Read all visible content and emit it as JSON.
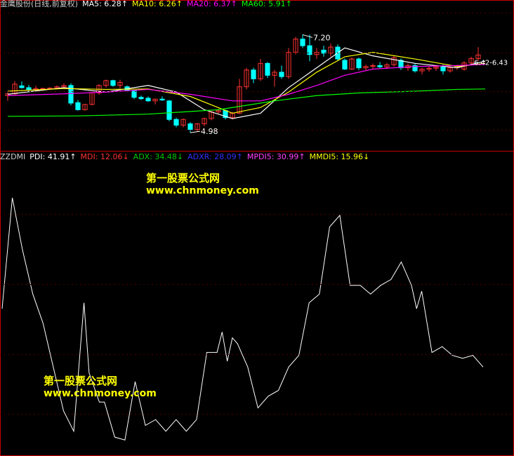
{
  "colors": {
    "background": "#000000",
    "up": "#ff3232",
    "down": "#00ffff",
    "axis_red": "#c80000",
    "grid_red": "#500000",
    "ma5": "#ffffff",
    "ma10": "#ffff00",
    "ma20": "#ff00ff",
    "ma60": "#00ff00",
    "pdi": "#ffffff",
    "mdi": "#ff0000",
    "adx": "#00c800",
    "adxr": "#2020ff",
    "mpdi5": "#ff40ff",
    "mmdi5": "#ffff00"
  },
  "top_legend": {
    "title": "金鹰股份(日线,前复权)",
    "ma5": "MA5: 6.28↑",
    "ma10": "MA10: 6.26↑",
    "ma20": "MA20: 6.37↑",
    "ma60": "MA60: 5.91↑"
  },
  "bottom_legend": {
    "title": "ZZDMI",
    "pdi": "PDI: 41.91↑",
    "mdi": "MDI: 12.06↓",
    "adx": "ADX: 34.48↓",
    "adxr": "ADXR: 28.09↑",
    "mpdi5": "MPDI5: 30.99↑",
    "mmdi5": "MMDI5: 15.96↓"
  },
  "watermarks": [
    {
      "cn": "第一股票公式网",
      "url": "www.chnmoney.com"
    },
    {
      "cn": "第一股票公式网",
      "url": "www.chnmoney.com"
    }
  ],
  "chart_data": [
    {
      "type": "candlestick",
      "ylim": [
        4.6,
        7.7
      ],
      "annotations": {
        "high": "7.20",
        "low": "4.98",
        "last_range": "6.42-6.43"
      },
      "candles": [
        [
          5.82,
          5.9,
          5.7,
          5.86
        ],
        [
          5.86,
          6.15,
          5.82,
          6.08
        ],
        [
          6.04,
          6.14,
          5.98,
          6.0
        ],
        [
          6.0,
          6.06,
          5.9,
          5.96
        ],
        [
          5.96,
          6.04,
          5.92,
          5.98
        ],
        [
          5.98,
          6.0,
          5.95,
          5.98
        ],
        [
          5.98,
          6.01,
          5.95,
          5.99
        ],
        [
          5.99,
          6.05,
          5.96,
          6.02
        ],
        [
          6.02,
          6.1,
          5.98,
          6.05
        ],
        [
          6.05,
          6.1,
          5.6,
          5.65
        ],
        [
          5.66,
          5.72,
          5.48,
          5.5
        ],
        [
          5.5,
          5.63,
          5.48,
          5.62
        ],
        [
          5.62,
          5.9,
          5.6,
          5.88
        ],
        [
          5.88,
          6.08,
          5.84,
          6.05
        ],
        [
          6.05,
          6.18,
          6.0,
          6.16
        ],
        [
          6.16,
          6.18,
          6.02,
          6.05
        ],
        [
          6.05,
          6.18,
          5.98,
          6.12
        ],
        [
          6.02,
          6.05,
          5.9,
          5.93
        ],
        [
          5.93,
          5.95,
          5.74,
          5.78
        ],
        [
          5.78,
          5.82,
          5.72,
          5.75
        ],
        [
          5.76,
          5.8,
          5.68,
          5.7
        ],
        [
          5.7,
          5.75,
          5.62,
          5.74
        ],
        [
          5.74,
          5.8,
          5.7,
          5.72
        ],
        [
          5.7,
          5.72,
          5.24,
          5.28
        ],
        [
          5.28,
          5.32,
          5.1,
          5.15
        ],
        [
          5.15,
          5.3,
          5.1,
          5.28
        ],
        [
          5.18,
          5.22,
          4.98,
          5.05
        ],
        [
          5.05,
          5.2,
          5.0,
          5.18
        ],
        [
          5.18,
          5.32,
          5.12,
          5.3
        ],
        [
          5.3,
          5.48,
          5.26,
          5.45
        ],
        [
          5.45,
          5.52,
          5.4,
          5.48
        ],
        [
          5.48,
          5.5,
          5.28,
          5.32
        ],
        [
          5.32,
          5.45,
          5.28,
          5.42
        ],
        [
          5.42,
          6.2,
          5.4,
          6.02
        ],
        [
          6.02,
          6.45,
          5.96,
          6.4
        ],
        [
          6.4,
          6.45,
          6.1,
          6.2
        ],
        [
          6.2,
          6.65,
          6.15,
          6.55
        ],
        [
          6.55,
          6.58,
          6.22,
          6.28
        ],
        [
          6.28,
          6.4,
          6.02,
          6.35
        ],
        [
          6.35,
          6.5,
          6.2,
          6.25
        ],
        [
          6.25,
          6.9,
          6.2,
          6.8
        ],
        [
          6.8,
          7.15,
          6.75,
          7.1
        ],
        [
          7.1,
          7.2,
          6.9,
          6.95
        ],
        [
          6.95,
          7.2,
          6.6,
          6.75
        ],
        [
          6.75,
          6.9,
          6.65,
          6.8
        ],
        [
          6.85,
          6.95,
          6.7,
          6.78
        ],
        [
          6.78,
          7.0,
          6.7,
          6.92
        ],
        [
          6.92,
          6.98,
          6.6,
          6.65
        ],
        [
          6.62,
          6.66,
          6.4,
          6.42
        ],
        [
          6.42,
          6.68,
          6.4,
          6.65
        ],
        [
          6.65,
          6.68,
          6.4,
          6.45
        ],
        [
          6.45,
          6.52,
          6.38,
          6.48
        ],
        [
          6.48,
          6.55,
          6.42,
          6.5
        ],
        [
          6.5,
          6.58,
          6.44,
          6.47
        ],
        [
          6.47,
          6.56,
          6.42,
          6.52
        ],
        [
          6.52,
          6.72,
          6.48,
          6.68
        ],
        [
          6.62,
          6.66,
          6.4,
          6.45
        ],
        [
          6.45,
          6.55,
          6.38,
          6.5
        ],
        [
          6.5,
          6.54,
          6.34,
          6.38
        ],
        [
          6.38,
          6.45,
          6.3,
          6.42
        ],
        [
          6.42,
          6.48,
          6.36,
          6.44
        ],
        [
          6.44,
          6.5,
          6.38,
          6.47
        ],
        [
          6.47,
          6.52,
          6.3,
          6.38
        ],
        [
          6.38,
          6.48,
          6.34,
          6.45
        ],
        [
          6.45,
          6.52,
          6.4,
          6.48
        ],
        [
          6.42,
          6.6,
          6.38,
          6.56
        ],
        [
          6.56,
          6.7,
          6.5,
          6.66
        ],
        [
          6.66,
          6.92,
          6.6,
          6.74
        ]
      ],
      "ma": {
        "ma5": [
          [
            0,
            5.85
          ],
          [
            8,
            6.0
          ],
          [
            14,
            5.9
          ],
          [
            20,
            6.05
          ],
          [
            24,
            5.9
          ],
          [
            28,
            5.5
          ],
          [
            32,
            5.3
          ],
          [
            36,
            5.42
          ],
          [
            40,
            6.0
          ],
          [
            44,
            6.45
          ],
          [
            48,
            6.9
          ],
          [
            52,
            6.72
          ],
          [
            58,
            6.55
          ],
          [
            64,
            6.45
          ],
          [
            68,
            6.6
          ]
        ],
        "ma10": [
          [
            0,
            5.92
          ],
          [
            8,
            5.98
          ],
          [
            14,
            5.96
          ],
          [
            20,
            5.97
          ],
          [
            26,
            5.8
          ],
          [
            32,
            5.42
          ],
          [
            36,
            5.55
          ],
          [
            40,
            5.9
          ],
          [
            44,
            6.35
          ],
          [
            48,
            6.7
          ],
          [
            52,
            6.8
          ],
          [
            58,
            6.65
          ],
          [
            64,
            6.48
          ],
          [
            68,
            6.55
          ]
        ],
        "ma20": [
          [
            0,
            5.82
          ],
          [
            8,
            5.86
          ],
          [
            14,
            5.9
          ],
          [
            20,
            5.96
          ],
          [
            26,
            5.85
          ],
          [
            32,
            5.7
          ],
          [
            36,
            5.7
          ],
          [
            40,
            5.85
          ],
          [
            44,
            6.05
          ],
          [
            48,
            6.28
          ],
          [
            52,
            6.42
          ],
          [
            58,
            6.48
          ],
          [
            64,
            6.5
          ],
          [
            68,
            6.53
          ]
        ],
        "ma60": [
          [
            0,
            5.35
          ],
          [
            10,
            5.36
          ],
          [
            20,
            5.4
          ],
          [
            30,
            5.5
          ],
          [
            38,
            5.7
          ],
          [
            44,
            5.82
          ],
          [
            50,
            5.88
          ],
          [
            58,
            5.92
          ],
          [
            64,
            5.96
          ],
          [
            68,
            5.97
          ]
        ]
      }
    },
    {
      "type": "line",
      "ylim": [
        0,
        100
      ],
      "series": [
        {
          "name": "PDI",
          "values": [
            [
              0,
              50
            ],
            [
              4,
              88
            ],
            [
              8,
              70
            ],
            [
              12,
              55
            ],
            [
              16,
              45
            ],
            [
              20,
              30
            ],
            [
              24,
              15
            ],
            [
              28,
              8
            ],
            [
              30,
              30
            ],
            [
              32,
              52
            ],
            [
              34,
              28
            ],
            [
              38,
              18
            ],
            [
              40,
              18
            ],
            [
              44,
              6
            ],
            [
              48,
              5
            ],
            [
              52,
              25
            ],
            [
              56,
              10
            ],
            [
              60,
              12
            ],
            [
              64,
              8
            ],
            [
              68,
              12
            ],
            [
              72,
              8
            ],
            [
              76,
              12
            ],
            [
              80,
              35
            ],
            [
              84,
              35
            ],
            [
              86,
              42
            ],
            [
              88,
              32
            ],
            [
              90,
              40
            ],
            [
              92,
              38
            ],
            [
              96,
              30
            ],
            [
              100,
              16
            ],
            [
              104,
              20
            ],
            [
              108,
              22
            ],
            [
              112,
              30
            ],
            [
              116,
              34
            ],
            [
              120,
              52
            ],
            [
              124,
              55
            ],
            [
              128,
              78
            ],
            [
              132,
              82
            ],
            [
              136,
              58
            ],
            [
              140,
              58
            ],
            [
              144,
              55
            ],
            [
              148,
              58
            ],
            [
              152,
              60
            ],
            [
              156,
              66
            ],
            [
              160,
              58
            ],
            [
              162,
              50
            ],
            [
              164,
              56
            ],
            [
              168,
              35
            ],
            [
              172,
              37
            ],
            [
              176,
              34
            ],
            [
              180,
              33
            ],
            [
              184,
              34
            ],
            [
              188,
              30
            ]
          ]
        }
      ]
    }
  ]
}
